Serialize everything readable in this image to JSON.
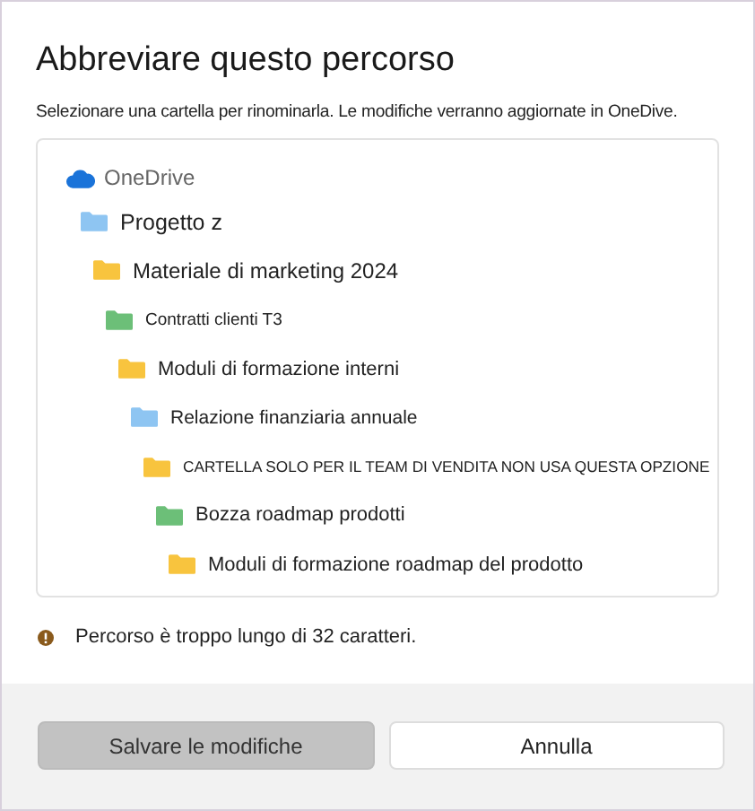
{
  "dialog": {
    "title": "Abbreviare questo percorso",
    "description": "Selezionare una cartella per rinominarla. Le modifiche verranno aggiornate in OneDive."
  },
  "tree": {
    "root": "OneDrive",
    "folders": [
      {
        "name": "Progetto z",
        "color": "#8ec5f2",
        "children": [
          {
            "name": "Materiale di marketing 2024",
            "color": "#f8c43e",
            "children": [
              {
                "name": "Contratti clienti T3",
                "color": "#6cbf78",
                "children": [
                  {
                    "name": "Moduli di formazione interni",
                    "color": "#f8c43e",
                    "children": [
                      {
                        "name": "Relazione finanziaria annuale",
                        "color": "#8ec5f2",
                        "children": [
                          {
                            "name": "CARTELLA SOLO PER IL TEAM DI VENDITA NON USA QUESTA OPZIONE",
                            "color": "#f8c43e",
                            "children": [
                              {
                                "name": "Bozza roadmap prodotti",
                                "color": "#6cbf78",
                                "children": [
                                  {
                                    "name": "Moduli di formazione roadmap del prodotto",
                                    "color": "#f8c43e"
                                  }
                                ]
                              }
                            ]
                          }
                        ]
                      }
                    ]
                  }
                ]
              }
            ]
          }
        ]
      }
    ]
  },
  "warning": "Percorso è troppo lungo di 32 caratteri.",
  "buttons": [
    {
      "label": "Salvare le modifiche",
      "disabled": true
    },
    {
      "label": "Annulla",
      "disabled": false
    }
  ]
}
